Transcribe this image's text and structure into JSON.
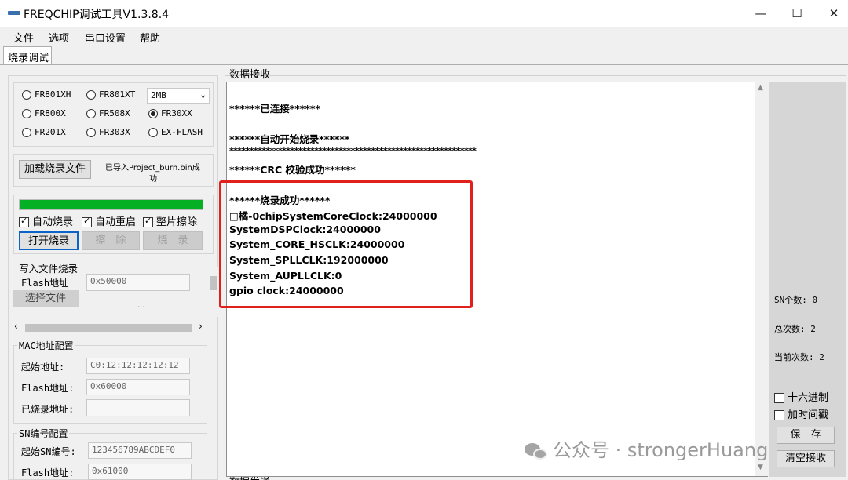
{
  "window": {
    "title": "FREQCHIP调试工具V1.3.8.4",
    "minimize": "—",
    "maximize": "☐",
    "close": "✕"
  },
  "menu": [
    "文件",
    "选项",
    "串口设置",
    "帮助"
  ],
  "tab": "烧录调试",
  "chips": {
    "options": [
      "FR801XH",
      "FR801XT",
      "FR800X",
      "FR508X",
      "FR30XX",
      "FR201X",
      "FR303X",
      "EX-FLASH"
    ],
    "selected": "FR30XX",
    "size_value": "2MB"
  },
  "load": {
    "button": "加载烧录文件",
    "status_line1": "已导入Project_burn.bin成",
    "status_line2": "功"
  },
  "progress": {
    "fraction": 1.0,
    "color": "#06b025"
  },
  "options": {
    "auto_burn": "自动烧录",
    "auto_restart": "自动重启",
    "chip_erase": "整片擦除"
  },
  "actions": {
    "open_burn": "打开烧录",
    "erase": "擦　除",
    "burn": "烧　录"
  },
  "write_file": {
    "title": "写入文件烧录",
    "flash_label": "Flash地址",
    "flash_value": "0x50000",
    "select_file": "选择文件",
    "ellipsis": "..."
  },
  "mac": {
    "title": "MAC地址配置",
    "start_label": "起始地址:",
    "start_value": "C0:12:12:12:12:12",
    "flash_label": "Flash地址:",
    "flash_value": "0x60000",
    "burned_label": "已烧录地址:",
    "burned_value": ""
  },
  "sn": {
    "title": "SN编号配置",
    "start_label": "起始SN编号:",
    "start_value": "123456789ABCDEF0",
    "flash_label": "Flash地址:",
    "flash_value": "0x61000"
  },
  "receive": {
    "label": "数据接收",
    "lines": [
      "******已连接******",
      "******自动开始烧录******",
      "*************************************************************",
      "******CRC 校验成功******",
      "******烧录成功******",
      "□橘-0chipSystemCoreClock:24000000",
      "SystemDSPClock:24000000",
      "System_CORE_HSCLK:24000000",
      "System_SPLLCLK:192000000",
      "System_AUPLLCLK:0",
      "gpio clock:24000000"
    ]
  },
  "stats": {
    "sn_count": "SN个数: 0",
    "total": "总次数: 2",
    "current": "当前次数: 2"
  },
  "side_options": {
    "hex": "十六进制",
    "timestamp": "加时间戳"
  },
  "side_buttons": {
    "save": "保　存",
    "clear": "清空接收"
  },
  "send_label": "数据发送",
  "watermark": "公众号 · strongerHuang"
}
